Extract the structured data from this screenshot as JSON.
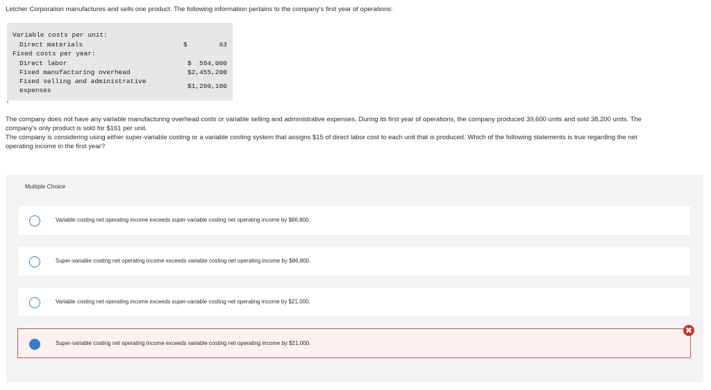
{
  "intro_text": "Letcher Corporation manufactures and sells one product. The following information pertains to the company's first year of operations:",
  "data_table": {
    "rows": [
      {
        "label": "Variable costs per unit:",
        "currency": "",
        "value": ""
      },
      {
        "label": "Direct materials",
        "currency": "$",
        "value": "63"
      },
      {
        "label": "Fixed costs per year:",
        "currency": "",
        "value": ""
      },
      {
        "label": "Direct labor",
        "currency": "",
        "value": "$  594,000"
      },
      {
        "label": "Fixed manufacturing overhead",
        "currency": "",
        "value": "$2,455,200"
      },
      {
        "label": "Fixed selling and administrative",
        "currency": "",
        "value": "$1,260,100"
      },
      {
        "label": "expenses",
        "currency": "",
        "value": ""
      }
    ]
  },
  "paragraph1_line1": "The company does not have any variable manufacturing overhead costs or variable selling and administrative expenses. During its first year of operations, the company produced 39,600 units and sold 38,200 units. The",
  "paragraph1_line2": "company's only product is sold for $161 per unit.",
  "paragraph2_line1": "The company is considering using either super-variable costing or a variable costing system that assigns $15 of direct labor cost to each unit that is produced. Which of the following statements is true regarding the net",
  "paragraph2_line2": "operating income in the first year?",
  "multiple_choice": {
    "label": "Multiple Choice",
    "options": [
      {
        "text": "Variable costing net operating income exceeds super-variable costing net operating income by $86,800.",
        "selected": false
      },
      {
        "text": "Super-variable costing net operating income exceeds variable costing net operating income by $86,800.",
        "selected": false
      },
      {
        "text": "Variable costing net operating income exceeds super-variable costing net operating income by $21,000.",
        "selected": false
      },
      {
        "text": "Super-variable costing net operating income exceeds variable costing net operating income by $21,000.",
        "selected": true
      }
    ],
    "incorrect_mark": "✖"
  },
  "colors": {
    "accent": "#3a7bc8",
    "error": "#c8362f",
    "panel": "#f3f3f3",
    "table_bg": "#e6e7e8"
  }
}
